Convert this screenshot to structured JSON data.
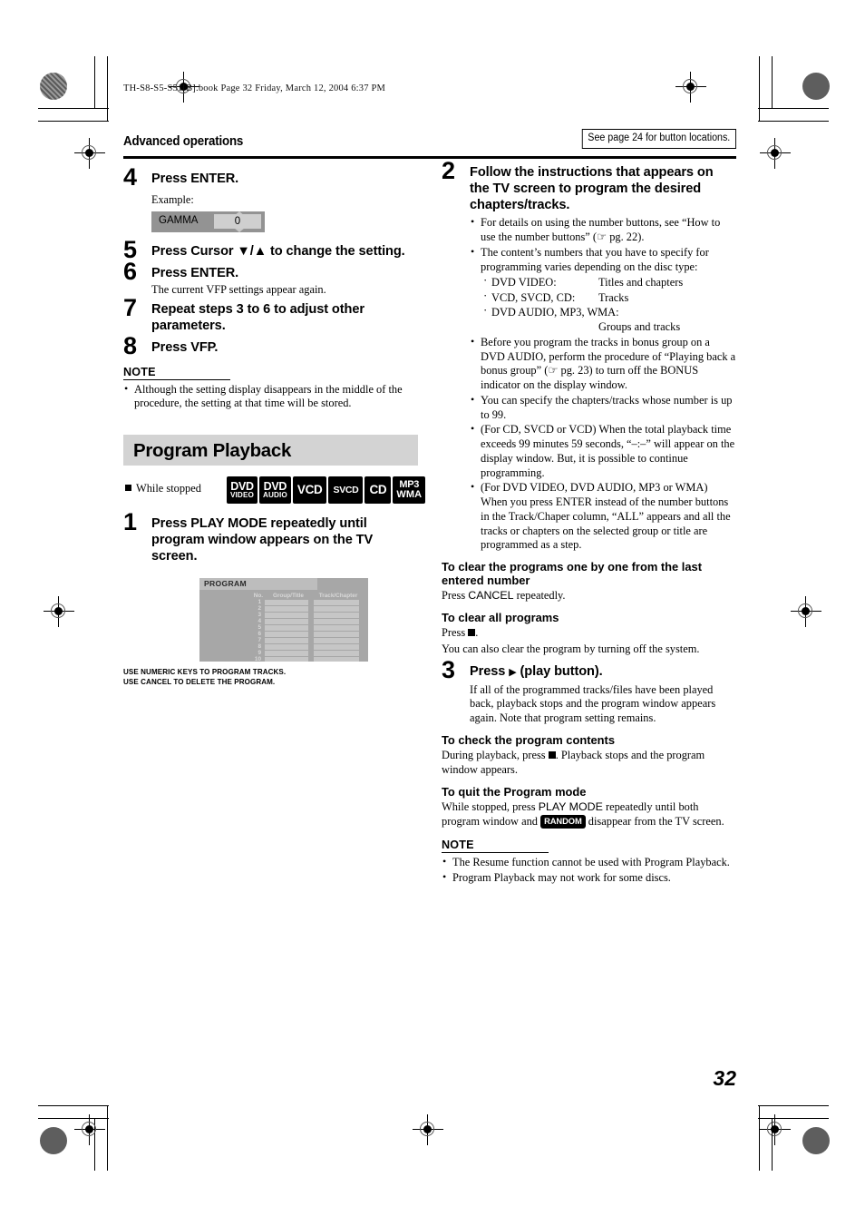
{
  "document": {
    "file_stamp": "TH-S8-S5-S51[B].book  Page 32  Friday, March 12, 2004  6:37 PM",
    "page_number": "32"
  },
  "header": {
    "section_title": "Advanced operations",
    "note_box": "See page 24 for button locations."
  },
  "left_column": {
    "steps": [
      {
        "num": "4",
        "head": "Press ENTER.",
        "example_label": "Example:"
      },
      {
        "num": "5",
        "head": "Press Cursor ▼/▲ to change the setting."
      },
      {
        "num": "6",
        "head": "Press ENTER.",
        "body": "The current VFP settings appear again."
      },
      {
        "num": "7",
        "head": "Repeat steps 3 to 6 to adjust other parameters."
      },
      {
        "num": "8",
        "head": "Press VFP."
      }
    ],
    "gamma_osd": {
      "name": "GAMMA",
      "value": "0"
    },
    "note": {
      "title": "NOTE",
      "items": [
        "Although the setting display disappears in the middle of the procedure, the setting at that time will be stored."
      ]
    },
    "banner_title": "Program Playback",
    "while_stopped": "While stopped",
    "disc_icons": [
      {
        "line1": "DVD",
        "line2": "VIDEO"
      },
      {
        "line1": "DVD",
        "line2": "AUDIO"
      },
      {
        "line1": "VCD",
        "line2": ""
      },
      {
        "line1": "SVCD",
        "line2": ""
      },
      {
        "line1": "CD",
        "line2": ""
      },
      {
        "line1": "MP3",
        "line2": "WMA"
      }
    ],
    "step1": {
      "num": "1",
      "head": "Press PLAY MODE repeatedly until program window appears on the TV screen."
    },
    "program_window": {
      "title": "PROGRAM",
      "columns": [
        "No.",
        "Group/Title",
        "Track/Chapter"
      ],
      "rows": [
        "1",
        "2",
        "3",
        "4",
        "5",
        "6",
        "7",
        "8",
        "9",
        "10"
      ],
      "caption_line1": "USE NUMERIC KEYS TO PROGRAM TRACKS.",
      "caption_line2": "USE CANCEL TO DELETE THE PROGRAM."
    }
  },
  "right_column": {
    "step2": {
      "num": "2",
      "head": "Follow the instructions that appears on the TV screen to program the desired chapters/tracks.",
      "bullets": [
        "For details on using the number buttons, see “How to use the number buttons” (☞ pg. 22).",
        "The content’s numbers that you have to specify for programming varies depending on the disc type:",
        "Before you program the tracks in bonus group on a DVD AUDIO, perform the procedure of “Playing back a bonus group” (☞ pg. 23) to turn off the BONUS indicator on the display window.",
        "You can specify the chapters/tracks whose number is up to 99.",
        "(For CD, SVCD or VCD) When the total playback time exceeds 99 minutes 59 seconds, “–:–” will appear on the display window. But, it is possible to continue programming.",
        "(For DVD VIDEO, DVD AUDIO, MP3 or WMA) When you press ENTER instead of the number buttons in the Track/Chaper column, “ALL” appears and all the tracks or chapters on the selected group or title are programmed as a step."
      ],
      "disc_types": [
        {
          "type": "DVD VIDEO:",
          "content": "Titles and chapters"
        },
        {
          "type": "VCD, SVCD, CD:",
          "content": "Tracks"
        },
        {
          "type": "DVD AUDIO, MP3, WMA:",
          "content": "Groups and tracks"
        }
      ]
    },
    "clear_one": {
      "head": "To clear the programs one by one from the last entered number",
      "body_pre": "Press ",
      "body_key": "CANCEL",
      "body_post": " repeatedly."
    },
    "clear_all": {
      "head": "To clear all programs",
      "body_press": "Press",
      "body_extra": "You can also clear the program by turning off the system."
    },
    "step3": {
      "num": "3",
      "head_pre": "Press ",
      "head_arrow": "▶",
      "head_post": " (play button).",
      "body": "If all of the programmed tracks/files have been played back, playback stops and the program window appears again. Note that program setting remains."
    },
    "check_contents": {
      "head": "To check the program contents",
      "body_pre": "During playback, press ",
      "body_post": ". Playback stops and the program window appears."
    },
    "quit_mode": {
      "head": "To quit the Program mode",
      "body_pre": "While stopped, press ",
      "body_key": "PLAY MODE",
      "body_mid": " repeatedly until both program window and ",
      "badge": "RANDOM",
      "body_post": " disappear from the TV screen."
    },
    "note": {
      "title": "NOTE",
      "items": [
        "The Resume function cannot be used with Program Playback.",
        "Program Playback may not work for some discs."
      ]
    }
  }
}
